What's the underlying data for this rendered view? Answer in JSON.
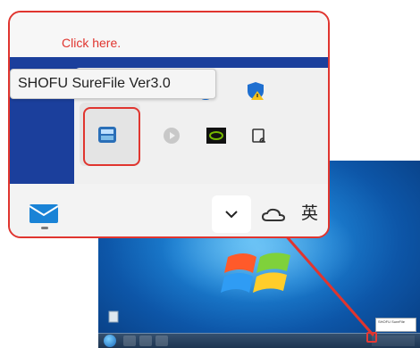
{
  "callout": {
    "instruction": "Click here.",
    "tooltip": "SHOFU SureFile Ver3.0",
    "language_indicator": "英"
  },
  "icons": {
    "tray": [
      "bluetooth-icon",
      "shield-warning-icon",
      "surefile-icon",
      "media-play-icon",
      "nvidia-icon",
      "cast-icon"
    ],
    "taskbar": [
      "mail-icon",
      "chevron-up-icon",
      "cloud-icon"
    ]
  },
  "desktop": {
    "mini_popup": "SHOFU SureFile"
  },
  "colors": {
    "highlight": "#e0352f",
    "accent_blue": "#1b3f9c"
  }
}
